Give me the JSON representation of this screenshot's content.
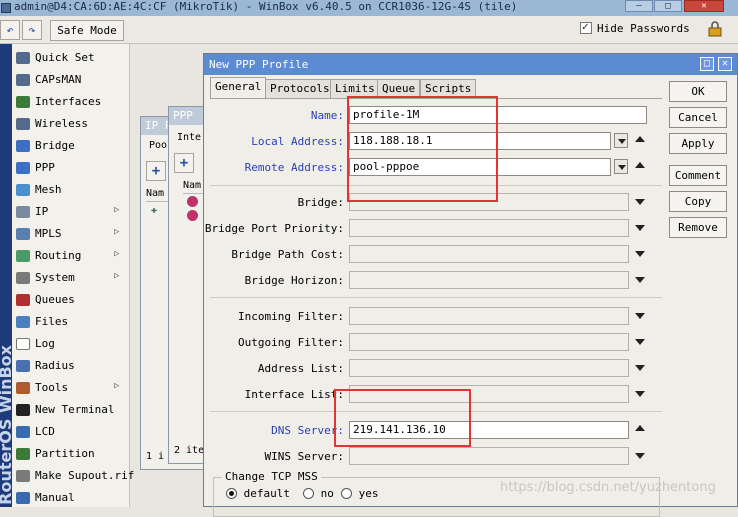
{
  "window": {
    "title": "admin@D4:CA:6D:AE:4C:CF (MikroTik) - WinBox v6.40.5 on CCR1036-12G-4S (tile)"
  },
  "toolbar": {
    "undo_icon": "undo-icon",
    "redo_icon": "redo-icon",
    "safe_mode_label": "Safe Mode",
    "hide_passwords_label": "Hide Passwords",
    "hide_passwords_checked": true
  },
  "brand": {
    "text": "RouterOS WinBox"
  },
  "sidebar": {
    "items": [
      {
        "label": "Quick Set",
        "icon": "wand-icon",
        "color": "#556b8e",
        "submenu": false
      },
      {
        "label": "CAPsMAN",
        "icon": "antenna-icon",
        "color": "#556b8e",
        "submenu": false
      },
      {
        "label": "Interfaces",
        "icon": "interfaces-icon",
        "color": "#3a7a3a",
        "submenu": false
      },
      {
        "label": "Wireless",
        "icon": "antenna-icon",
        "color": "#556b8e",
        "submenu": false
      },
      {
        "label": "Bridge",
        "icon": "bridge-icon",
        "color": "#3d6fc7",
        "submenu": false
      },
      {
        "label": "PPP",
        "icon": "ppp-icon",
        "color": "#3d6fc7",
        "submenu": false
      },
      {
        "label": "Mesh",
        "icon": "mesh-icon",
        "color": "#4a90d0",
        "submenu": false
      },
      {
        "label": "IP",
        "icon": "ip-icon",
        "color": "#7a8aa0",
        "submenu": true
      },
      {
        "label": "MPLS",
        "icon": "mpls-icon",
        "color": "#5a7fb0",
        "submenu": true
      },
      {
        "label": "Routing",
        "icon": "routing-icon",
        "color": "#4a9a6a",
        "submenu": true
      },
      {
        "label": "System",
        "icon": "gear-icon",
        "color": "#7a7a7a",
        "submenu": true
      },
      {
        "label": "Queues",
        "icon": "queues-icon",
        "color": "#b03030",
        "submenu": false
      },
      {
        "label": "Files",
        "icon": "folder-icon",
        "color": "#4a7fc0",
        "submenu": false
      },
      {
        "label": "Log",
        "icon": "log-icon",
        "color": "#ffffff",
        "submenu": false
      },
      {
        "label": "Radius",
        "icon": "radius-icon",
        "color": "#4a70b0",
        "submenu": false
      },
      {
        "label": "Tools",
        "icon": "tools-icon",
        "color": "#b05a30",
        "submenu": true
      },
      {
        "label": "New Terminal",
        "icon": "terminal-icon",
        "color": "#222222",
        "submenu": false
      },
      {
        "label": "LCD",
        "icon": "lcd-icon",
        "color": "#3a6ab0",
        "submenu": false
      },
      {
        "label": "Partition",
        "icon": "partition-icon",
        "color": "#3a7a3a",
        "submenu": false
      },
      {
        "label": "Make Supout.rif",
        "icon": "document-icon",
        "color": "#7a7a7a",
        "submenu": false
      },
      {
        "label": "Manual",
        "icon": "help-icon",
        "color": "#3a6ab0",
        "submenu": false
      }
    ]
  },
  "bg_windows": {
    "ip_pool": {
      "title": "IP P",
      "tab": "Pool",
      "col": "Nam",
      "status": "1 i"
    },
    "ppp": {
      "title": "PPP",
      "tab": "Inte",
      "col": "Nam",
      "status": "2 ite"
    }
  },
  "dialog": {
    "title": "New PPP Profile",
    "tabs": [
      "General",
      "Protocols",
      "Limits",
      "Queue",
      "Scripts"
    ],
    "active_tab": "General",
    "fields": {
      "name": {
        "label": "Name:",
        "value": "profile-1M"
      },
      "local_address": {
        "label": "Local Address:",
        "value": "118.188.18.1"
      },
      "remote_address": {
        "label": "Remote Address:",
        "value": "pool-pppoe"
      },
      "bridge": {
        "label": "Bridge:",
        "value": ""
      },
      "bridge_port_priority": {
        "label": "Bridge Port Priority:",
        "value": ""
      },
      "bridge_path_cost": {
        "label": "Bridge Path Cost:",
        "value": ""
      },
      "bridge_horizon": {
        "label": "Bridge Horizon:",
        "value": ""
      },
      "incoming_filter": {
        "label": "Incoming Filter:",
        "value": ""
      },
      "outgoing_filter": {
        "label": "Outgoing Filter:",
        "value": ""
      },
      "address_list": {
        "label": "Address List:",
        "value": ""
      },
      "interface_list": {
        "label": "Interface List:",
        "value": ""
      },
      "dns_server": {
        "label": "DNS Server:",
        "value": "219.141.136.10"
      },
      "wins_server": {
        "label": "WINS Server:",
        "value": ""
      }
    },
    "change_tcp_mss": {
      "label": "Change TCP MSS",
      "options": [
        "default",
        "no",
        "yes"
      ],
      "selected": "default"
    },
    "buttons": {
      "ok": "OK",
      "cancel": "Cancel",
      "apply": "Apply",
      "comment": "Comment",
      "copy": "Copy",
      "remove": "Remove"
    }
  },
  "watermark": "https://blog.csdn.net/yuzhentong"
}
